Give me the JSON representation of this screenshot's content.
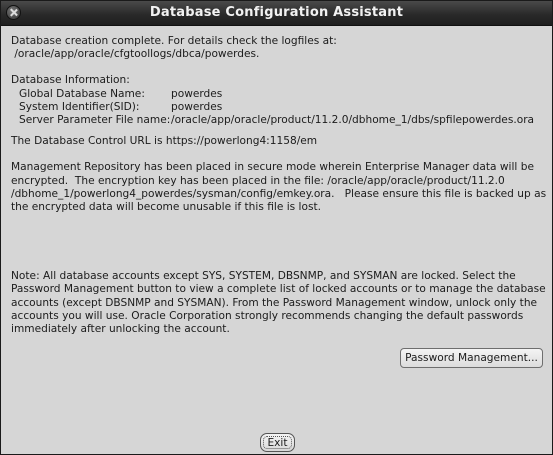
{
  "window": {
    "title": "Database Configuration Assistant"
  },
  "intro": {
    "line1": "Database creation complete. For details check the logfiles at:",
    "line2": " /oracle/app/oracle/cfgtoollogs/dbca/powerdes."
  },
  "info": {
    "heading": "Database Information:",
    "rows": [
      {
        "label": "Global Database Name:",
        "value": "powerdes"
      },
      {
        "label": "System Identifier(SID):",
        "value": "powerdes"
      },
      {
        "label": "Server Parameter File name:",
        "value": "/oracle/app/oracle/product/11.2.0/dbhome_1/dbs/spfilepowerdes.ora"
      }
    ]
  },
  "control_url": "The Database Control URL is https://powerlong4:1158/em",
  "repository": {
    "line1": "Management Repository has been placed in secure mode wherein Enterprise Manager data will be",
    "line2": "encrypted.  The encryption key has been placed in the file: /oracle/app/oracle/product/11.2.0",
    "line3": "/dbhome_1/powerlong4_powerdes/sysman/config/emkey.ora.   Please ensure this file is backed up as",
    "line4": "the encrypted data will become unusable if this file is lost."
  },
  "note": {
    "line1": "Note: All database accounts except SYS, SYSTEM, DBSNMP, and SYSMAN are locked. Select the",
    "line2": "Password Management button to view a complete list of locked accounts or to manage the database",
    "line3": "accounts (except DBSNMP and SYSMAN). From the Password Management window, unlock only the",
    "line4": "accounts you will use. Oracle Corporation strongly recommends changing the default passwords",
    "line5": "immediately after unlocking the account."
  },
  "buttons": {
    "password_management": "Password Management...",
    "exit": "Exit"
  },
  "icons": {
    "close": "close-icon"
  }
}
